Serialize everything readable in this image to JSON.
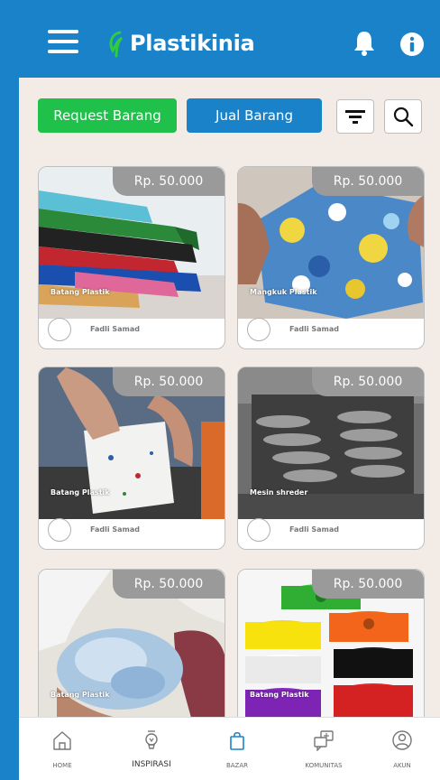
{
  "header": {
    "app_name": "Plastikinia"
  },
  "actions": {
    "request": "Request Barang",
    "jual": "Jual Barang"
  },
  "products": [
    {
      "price": "Rp. 50.000",
      "name": "Batang Plastik",
      "seller": "Fadli Samad",
      "image": "plastic-bars"
    },
    {
      "price": "Rp. 50.000",
      "name": "Mangkuk Plastik",
      "seller": "Fadli Samad",
      "image": "plastic-bowl"
    },
    {
      "price": "Rp. 50.000",
      "name": "Batang Plastik",
      "seller": "Fadli Samad",
      "image": "plastic-block"
    },
    {
      "price": "Rp. 50.000",
      "name": "Mesin shreder",
      "seller": "Fadli Samad",
      "image": "shredder"
    },
    {
      "price": "Rp. 50.000",
      "name": "Batang Plastik",
      "seller": "",
      "image": "plastic-flakes"
    },
    {
      "price": "Rp. 50.000",
      "name": "Batang Plastik",
      "seller": "",
      "image": "filament-spools"
    }
  ],
  "nav": {
    "home": "HOME",
    "inspirasi": "INSPIRASI",
    "bazar": "BAZAR",
    "komunitas": "KOMUNITAS",
    "akun": "AKUN"
  },
  "colors": {
    "primary": "#1a82c9",
    "accent_green": "#1fc14b",
    "background": "#f3ece6",
    "price_badge": "#9a9a9a"
  },
  "icons": [
    "menu-icon",
    "bell-icon",
    "info-icon",
    "filter-icon",
    "search-icon",
    "home-icon",
    "lightbulb-icon",
    "shopping-bag-icon",
    "community-icon",
    "account-icon"
  ]
}
